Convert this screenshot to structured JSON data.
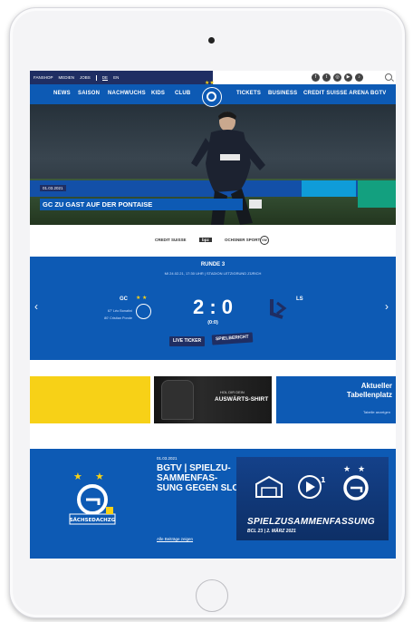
{
  "topbar": {
    "links": [
      "FANSHOP",
      "MEDIEN",
      "JOBS"
    ],
    "lang_de": "DE",
    "lang_en": "EN"
  },
  "nav": {
    "left": [
      "NEWS",
      "SAISON",
      "NACHWUCHS",
      "KIDS",
      "CLUB"
    ],
    "right": [
      "TICKETS",
      "BUSINESS",
      "CREDIT SUISSE ARENA",
      "BGTV"
    ]
  },
  "hero": {
    "date": "01.03.2021",
    "title": "GC ZU GAST AUF DER PONTAISE"
  },
  "sponsors": [
    "CREDIT SUISSE",
    "bpz",
    "OCHSNER SPORT",
    "VW"
  ],
  "match": {
    "round": "RUNDE 3",
    "info": "MI 24.02.21, 17:30 UHR | STADION LETZIGRUND ZÜRICH",
    "home_team": "GC",
    "away_team": "LS",
    "scorers": [
      "67' Léo Bonatini",
      "80' Cristian Ponde"
    ],
    "score": "2 : 0",
    "halftime": "(0:0)",
    "btn_live": "LIVE TICKER",
    "btn_report": "SPIELBERICHT"
  },
  "promo": {
    "shirt_small": "HOL DIR DEIN",
    "shirt_big": "AUSWÄRTS-SHIRT",
    "table_title_1": "Aktueller",
    "table_title_2": "Tabellenplatz",
    "table_link": "Tabelle anzeigen"
  },
  "bottom": {
    "crest_text": "SÄCHSEDACHZG",
    "btv_date": "01.03.2021",
    "btv_title": "BGTV | SPIELZU-SAMMENFAS-SUNG GEGEN SLO",
    "btv_link": "Alle Beiträge zeigen",
    "video_main": "SPIELZUSAMMENFASSUNG",
    "video_sub": "BCL 23 | 2. MÄRZ 2021"
  },
  "colors": {
    "brand_blue": "#0d5ab4",
    "navy": "#1f2e63",
    "yellow": "#f7d117"
  }
}
